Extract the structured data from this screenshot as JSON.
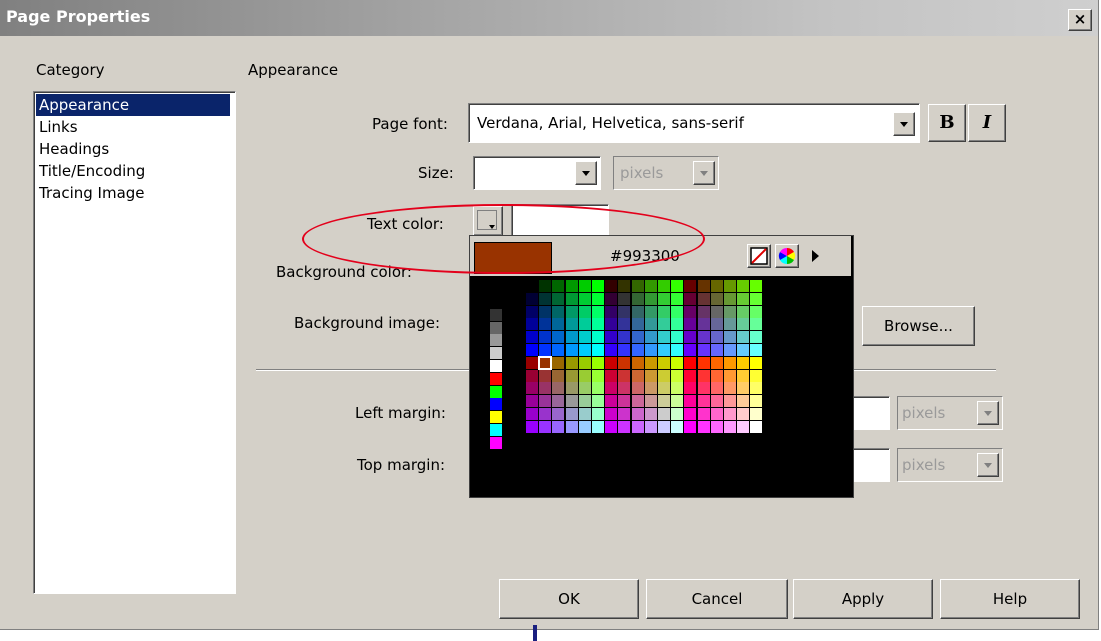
{
  "window": {
    "title": "Page Properties",
    "close_glyph": "×"
  },
  "category": {
    "heading": "Category",
    "items": [
      "Appearance",
      "Links",
      "Headings",
      "Title/Encoding",
      "Tracing Image"
    ],
    "selected_index": 0
  },
  "panel": {
    "heading": "Appearance",
    "page_font_label": "Page font:",
    "page_font_value": "Verdana, Arial, Helvetica, sans-serif",
    "bold_label": "B",
    "italic_label": "I",
    "size_label": "Size:",
    "size_value": "",
    "size_unit": "pixels",
    "text_color_label": "Text color:",
    "text_color_value": "",
    "bg_color_label": "Background color:",
    "bg_image_label": "Background image:",
    "browse_label": "Browse...",
    "left_margin_label": "Left margin:",
    "left_margin_unit": "pixels",
    "top_margin_label": "Top margin:",
    "top_margin_unit": "pixels"
  },
  "color_picker": {
    "selected_hex": "#993300",
    "selected_color": "#993300",
    "no_color_icon": "no-color-icon",
    "system_color_icon": "color-wheel-icon",
    "menu_icon": "right-arrow-icon"
  },
  "buttons": {
    "ok": "OK",
    "cancel": "Cancel",
    "apply": "Apply",
    "help": "Help"
  },
  "colors": {
    "dialog_bg": "#d4d0c8",
    "selection": "#0a246a",
    "annotation": "#e3001b"
  }
}
